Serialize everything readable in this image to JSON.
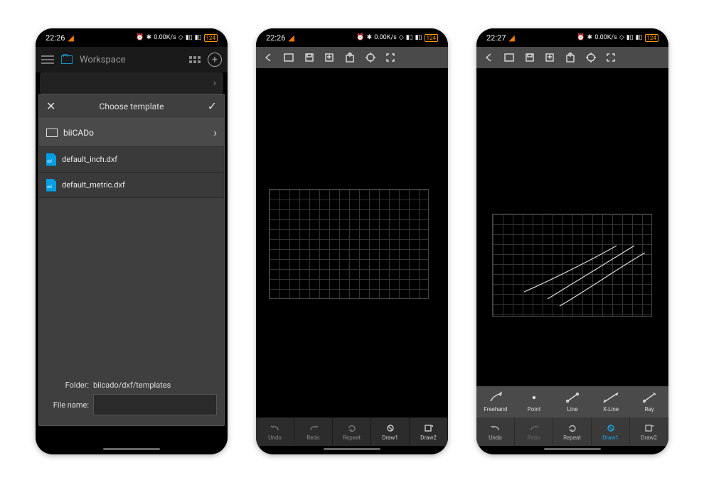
{
  "screen1": {
    "status": {
      "time": "22:26",
      "battery": "124"
    },
    "appbar": {
      "title": "Workspace"
    },
    "panel": {
      "title": "Choose template",
      "folder_row": "biiCADo",
      "files": [
        "default_inch.dxf",
        "default_metric.dxf"
      ],
      "folder_label": "Folder:",
      "folder_value": "biicado/dxf/templates",
      "filename_label": "File name:",
      "filename_value": ""
    }
  },
  "screen2": {
    "status": {
      "time": "22:26",
      "battery": "124"
    },
    "bottom": {
      "items": [
        {
          "label": "Undo"
        },
        {
          "label": "Redo"
        },
        {
          "label": "Repeat"
        },
        {
          "label": "Draw1"
        },
        {
          "label": "Draw2"
        }
      ]
    }
  },
  "screen3": {
    "status": {
      "time": "22:27",
      "battery": "124"
    },
    "drawbar": {
      "items": [
        {
          "label": "Freehand"
        },
        {
          "label": "Point"
        },
        {
          "label": "Line"
        },
        {
          "label": "X-Line"
        },
        {
          "label": "Ray"
        }
      ]
    },
    "bottom": {
      "items": [
        {
          "label": "Undo"
        },
        {
          "label": "Redo"
        },
        {
          "label": "Repeat"
        },
        {
          "label": "Draw1"
        },
        {
          "label": "Draw2"
        }
      ]
    }
  },
  "status_indicators": {
    "kbs": "0.00",
    "kbs_unit": "K/s"
  }
}
